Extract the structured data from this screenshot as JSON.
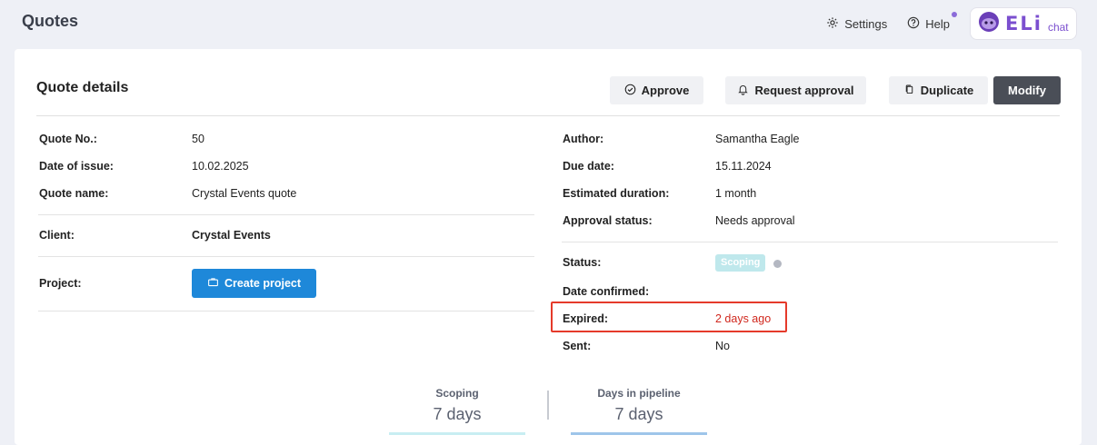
{
  "header": {
    "title": "Quotes",
    "settings_label": "Settings",
    "help_label": "Help",
    "eli_brand": "ELi",
    "eli_chat": "chat"
  },
  "card": {
    "title": "Quote details",
    "buttons": {
      "approve": "Approve",
      "request_approval": "Request approval",
      "duplicate": "Duplicate",
      "modify": "Modify"
    }
  },
  "left_fields": [
    {
      "label": "Quote No.:",
      "value": "50"
    },
    {
      "label": "Date of issue:",
      "value": "10.02.2025"
    },
    {
      "label": "Quote name:",
      "value": "Crystal Events quote"
    },
    {
      "label": "Client:",
      "value": "Crystal Events"
    },
    {
      "label": "Project:",
      "value": "Create project"
    }
  ],
  "right_fields": [
    {
      "label": "Author:",
      "value": "Samantha Eagle"
    },
    {
      "label": "Due date:",
      "value": "15.11.2024"
    },
    {
      "label": "Estimated duration:",
      "value": "1 month"
    },
    {
      "label": "Approval status:",
      "value": "Needs approval"
    },
    {
      "label": "Status:",
      "value": "Scoping"
    },
    {
      "label": "Date confirmed:",
      "value": ""
    },
    {
      "label": "Expired:",
      "value": "2 days ago"
    },
    {
      "label": "Sent:",
      "value": "No"
    }
  ],
  "stats": [
    {
      "label": "Scoping",
      "value": "7 days"
    },
    {
      "label": "Days in pipeline",
      "value": "7 days"
    }
  ],
  "colors": {
    "accent_blue": "#1e88d9",
    "expired_red": "#d0281e",
    "highlight_border": "#e53a2a",
    "status_pill": "#bfe8ec",
    "brand_purple": "#7b4fcf"
  }
}
